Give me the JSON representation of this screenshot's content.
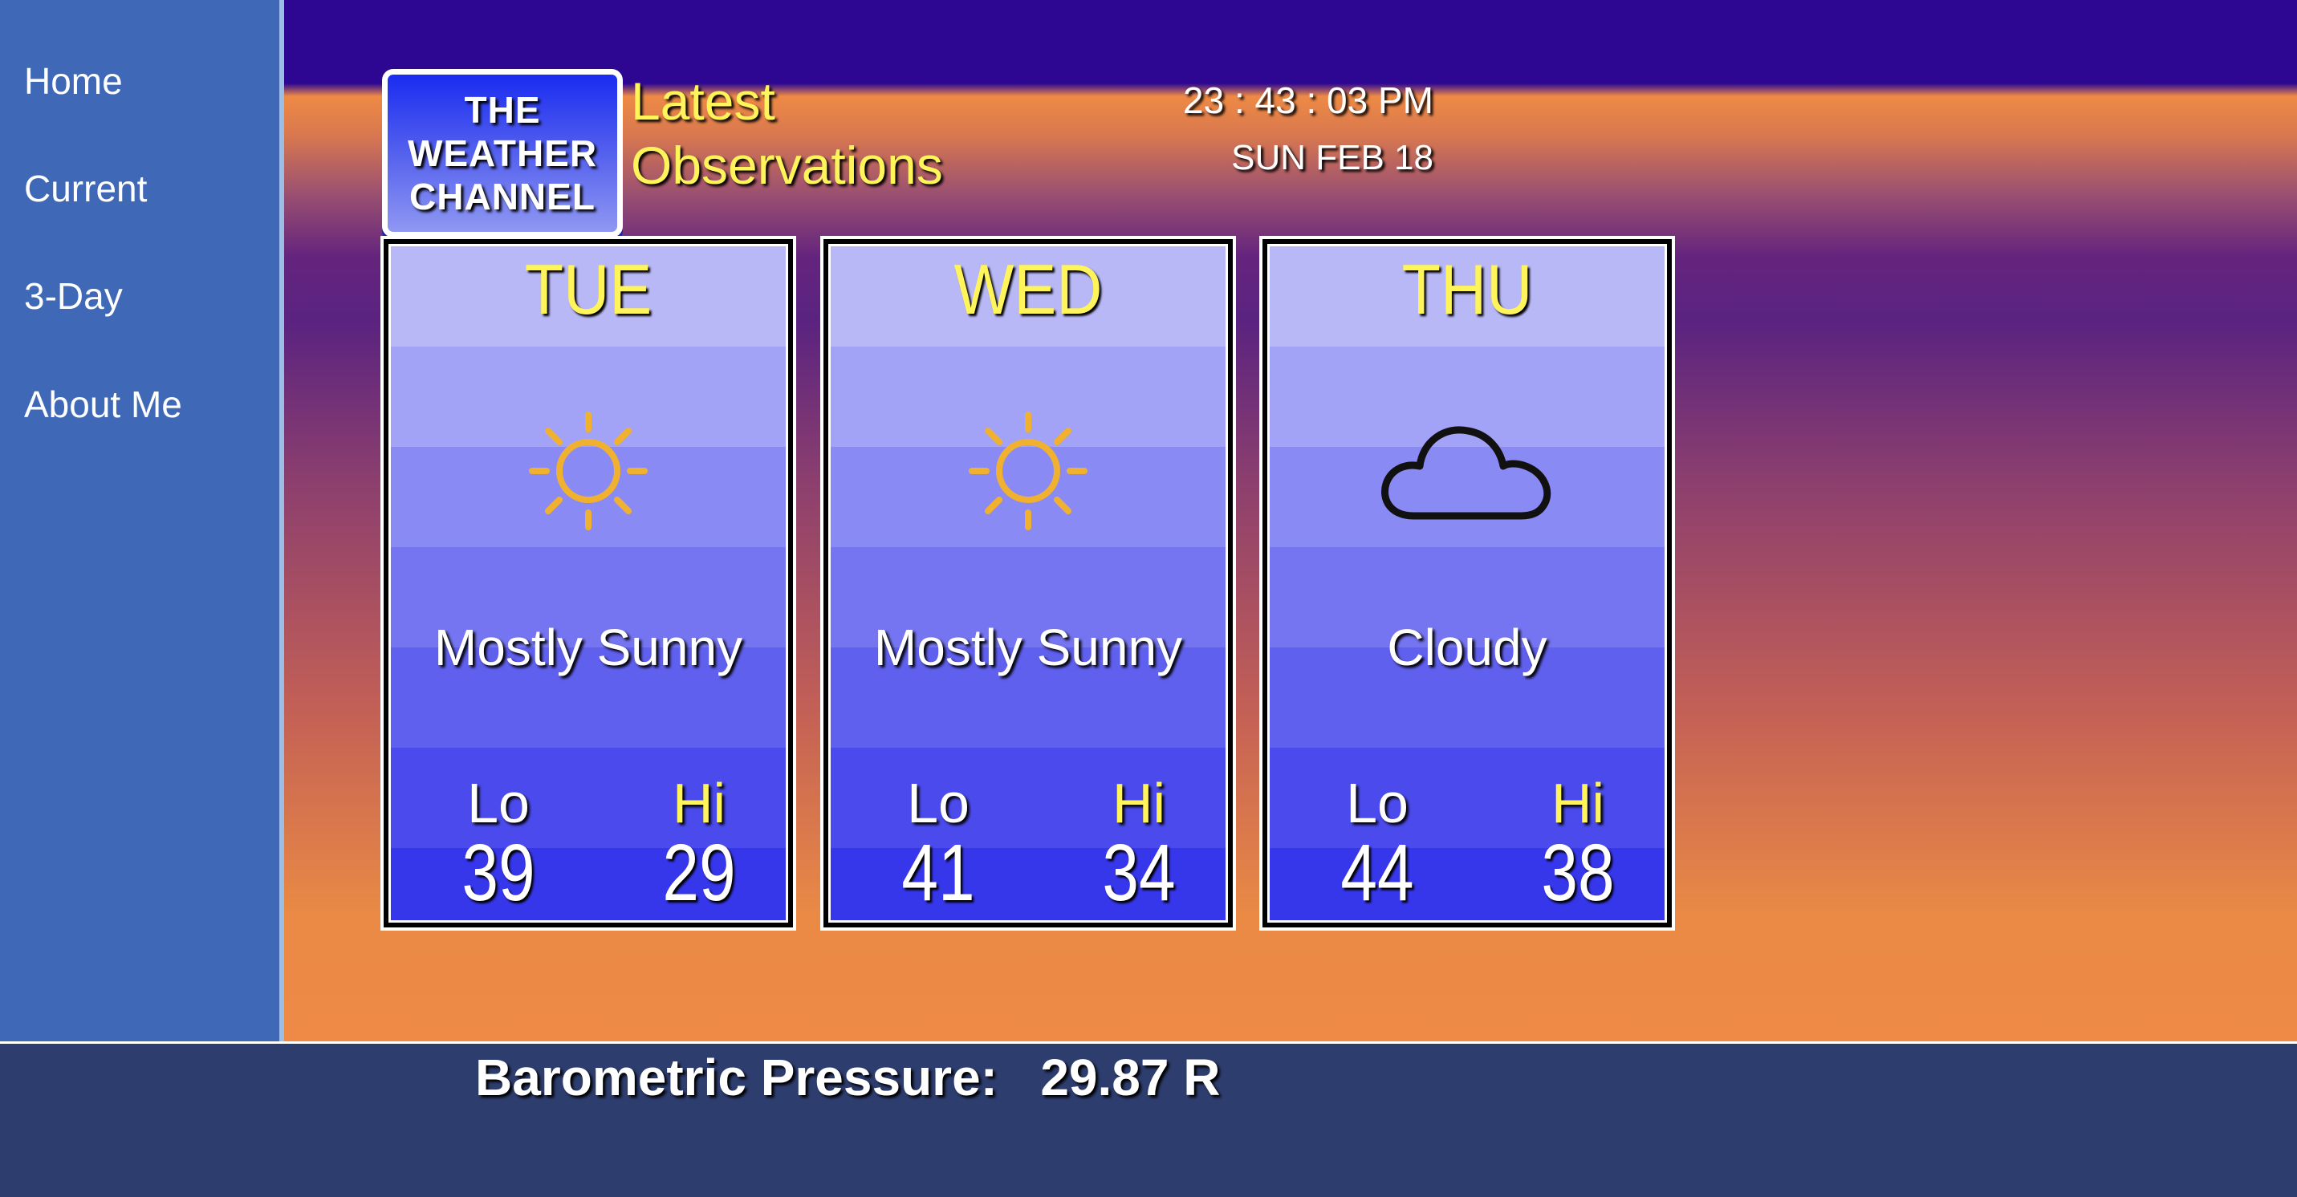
{
  "nav": {
    "items": [
      {
        "label": "Home"
      },
      {
        "label": "Current"
      },
      {
        "label": "3-Day"
      },
      {
        "label": "About Me"
      }
    ]
  },
  "logo": {
    "line1": "THE",
    "line2": "WEATHER",
    "line3": "CHANNEL"
  },
  "header": {
    "title_line1": "Latest",
    "title_line2": "Observations",
    "time": "23 : 43 : 03 PM",
    "date": "SUN FEB 18"
  },
  "forecast": [
    {
      "day": "TUE",
      "icon": "sun-icon",
      "condition": "Mostly Sunny",
      "lo_label": "Lo",
      "hi_label": "Hi",
      "lo": "39",
      "hi": "29"
    },
    {
      "day": "WED",
      "icon": "sun-icon",
      "condition": "Mostly Sunny",
      "lo_label": "Lo",
      "hi_label": "Hi",
      "lo": "41",
      "hi": "34"
    },
    {
      "day": "THU",
      "icon": "cloud-icon",
      "condition": "Cloudy",
      "lo_label": "Lo",
      "hi_label": "Hi",
      "lo": "44",
      "hi": "38"
    }
  ],
  "footer": {
    "pressure_label": "Barometric Pressure:",
    "pressure_value": "29.87 R"
  },
  "colors": {
    "title_yellow": "#fff45a",
    "sidebar_blue": "#3f69b6",
    "sun_orange": "#f0b030"
  }
}
